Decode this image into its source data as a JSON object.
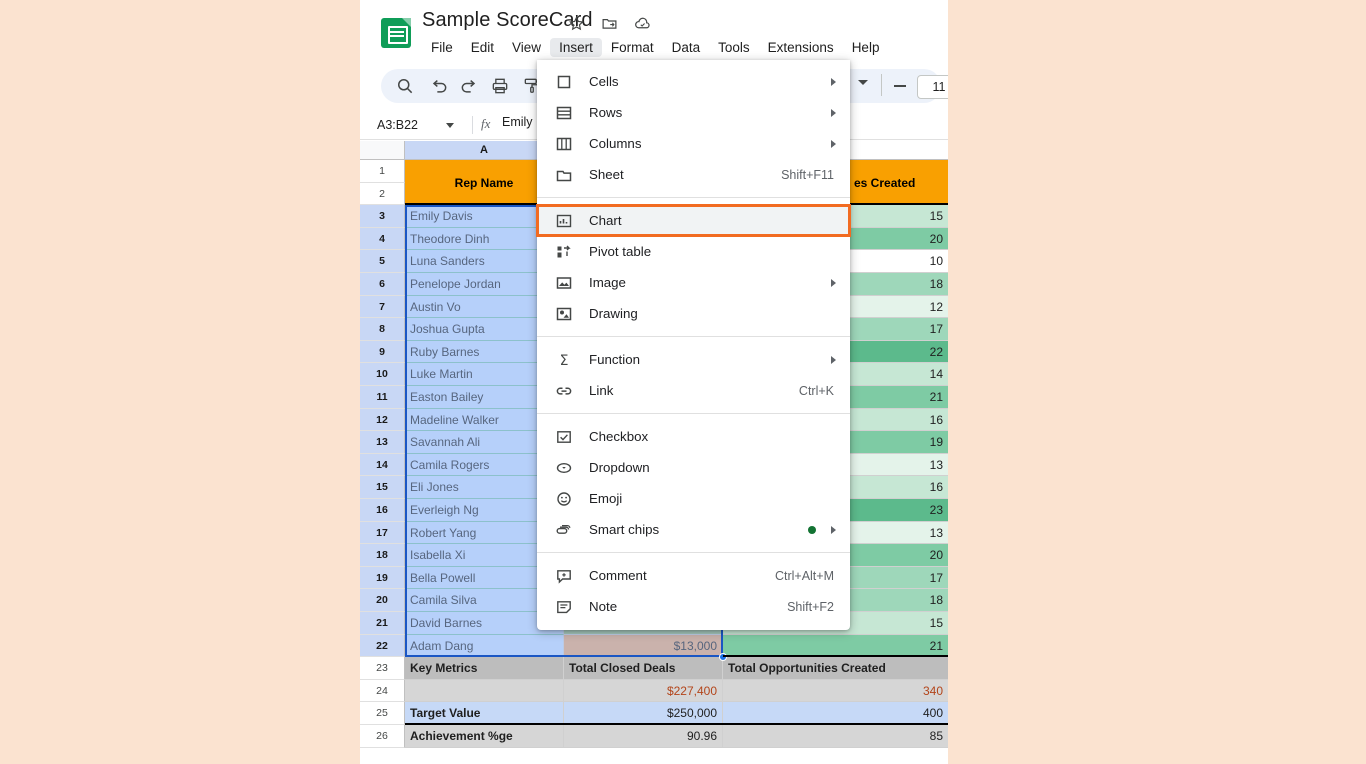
{
  "app": {
    "doc_title": "Sample ScoreCard",
    "title_icons": [
      "star-icon",
      "move-to-folder-icon",
      "cloud-saved-icon"
    ],
    "menubar": [
      "File",
      "Edit",
      "View",
      "Insert",
      "Format",
      "Data",
      "Tools",
      "Extensions",
      "Help"
    ],
    "active_menu": "Insert"
  },
  "toolbar": {
    "icons": [
      "search-icon",
      "undo-icon",
      "redo-icon",
      "print-icon",
      "paint-format-icon"
    ],
    "font_size": "11"
  },
  "formula_bar": {
    "name_box": "A3:B22",
    "fx_label": "fx",
    "formula_value": "Emily D"
  },
  "grid": {
    "column_headers": [
      "A"
    ],
    "header_row": {
      "col_a": "Rep Name",
      "col_c": "es Created"
    },
    "row_numbers": [
      "1",
      "2",
      "3",
      "4",
      "5",
      "6",
      "7",
      "8",
      "9",
      "10",
      "11",
      "12",
      "13",
      "14",
      "15",
      "16",
      "17",
      "18",
      "19",
      "20",
      "21",
      "22",
      "23",
      "24",
      "25",
      "26"
    ],
    "rep_rows": [
      {
        "row": "3",
        "name": "Emily Davis",
        "opps": "15",
        "shade": 2
      },
      {
        "row": "4",
        "name": "Theodore Dinh",
        "opps": "20",
        "shade": 4
      },
      {
        "row": "5",
        "name": "Luna Sanders",
        "opps": "10",
        "shade": 0
      },
      {
        "row": "6",
        "name": "Penelope Jordan",
        "opps": "18",
        "shade": 3
      },
      {
        "row": "7",
        "name": "Austin Vo",
        "opps": "12",
        "shade": 1
      },
      {
        "row": "8",
        "name": "Joshua Gupta",
        "opps": "17",
        "shade": 3
      },
      {
        "row": "9",
        "name": "Ruby Barnes",
        "opps": "22",
        "shade": 5
      },
      {
        "row": "10",
        "name": "Luke Martin",
        "opps": "14",
        "shade": 2
      },
      {
        "row": "11",
        "name": "Easton Bailey",
        "opps": "21",
        "shade": 4
      },
      {
        "row": "12",
        "name": "Madeline Walker",
        "opps": "16",
        "shade": 2
      },
      {
        "row": "13",
        "name": "Savannah Ali",
        "opps": "19",
        "shade": 4
      },
      {
        "row": "14",
        "name": "Camila Rogers",
        "opps": "13",
        "shade": 1
      },
      {
        "row": "15",
        "name": "Eli Jones",
        "opps": "16",
        "shade": 2
      },
      {
        "row": "16",
        "name": "Everleigh Ng",
        "opps": "23",
        "shade": 5
      },
      {
        "row": "17",
        "name": "Robert Yang",
        "opps": "13",
        "shade": 1
      },
      {
        "row": "18",
        "name": "Isabella Xi",
        "opps": "20",
        "shade": 4
      },
      {
        "row": "19",
        "name": "Bella Powell",
        "opps": "17",
        "shade": 3
      },
      {
        "row": "20",
        "name": "Camila Silva",
        "opps": "18",
        "shade": 3
      },
      {
        "row": "21",
        "name": "David Barnes",
        "opps": "15",
        "shade": 2
      },
      {
        "row": "22",
        "name": "Adam Dang",
        "opps": "21",
        "shade": 4,
        "deals": "$13,000"
      }
    ],
    "summary_rows": [
      {
        "row": "23",
        "label": "Key Metrics",
        "deals": "Total Closed Deals",
        "opps": "Total Opportunities Created",
        "style": "header"
      },
      {
        "row": "24",
        "label": "",
        "deals": "$227,400",
        "opps": "340",
        "style": "actual"
      },
      {
        "row": "25",
        "label": "Target Value",
        "deals": "$250,000",
        "opps": "400",
        "style": "target"
      },
      {
        "row": "26",
        "label": "Achievement %ge",
        "deals": "90.96",
        "opps": "85",
        "style": "achievement"
      }
    ]
  },
  "insert_menu": {
    "groups": [
      [
        {
          "label": "Cells",
          "icon": "cells-icon",
          "arrow": true
        },
        {
          "label": "Rows",
          "icon": "rows-icon",
          "arrow": true
        },
        {
          "label": "Columns",
          "icon": "columns-icon",
          "arrow": true
        },
        {
          "label": "Sheet",
          "icon": "sheet-icon",
          "shortcut": "Shift+F11"
        }
      ],
      [
        {
          "label": "Chart",
          "icon": "chart-icon",
          "highlighted": true
        },
        {
          "label": "Pivot table",
          "icon": "pivot-table-icon"
        },
        {
          "label": "Image",
          "icon": "image-icon",
          "arrow": true
        },
        {
          "label": "Drawing",
          "icon": "drawing-icon"
        }
      ],
      [
        {
          "label": "Function",
          "icon": "sigma-icon",
          "arrow": true
        },
        {
          "label": "Link",
          "icon": "link-icon",
          "shortcut": "Ctrl+K"
        }
      ],
      [
        {
          "label": "Checkbox",
          "icon": "checkbox-icon"
        },
        {
          "label": "Dropdown",
          "icon": "dropdown-icon"
        },
        {
          "label": "Emoji",
          "icon": "emoji-icon"
        },
        {
          "label": "Smart chips",
          "icon": "smart-chips-icon",
          "arrow": true,
          "dot": true
        }
      ],
      [
        {
          "label": "Comment",
          "icon": "comment-icon",
          "shortcut": "Ctrl+Alt+M"
        },
        {
          "label": "Note",
          "icon": "note-icon",
          "shortcut": "Shift+F2"
        }
      ]
    ]
  },
  "colors": {
    "accent_orange": "#f9a001",
    "highlight_orange": "#f26b21",
    "selection_blue": "#1a56c4",
    "sheets_green": "#0f9d58",
    "deal_orange": "#e8a670",
    "green_scale": [
      "#ffffff",
      "#e4f3ea",
      "#c6e7d4",
      "#9ed7ba",
      "#7ecba4",
      "#5cba8c"
    ]
  }
}
